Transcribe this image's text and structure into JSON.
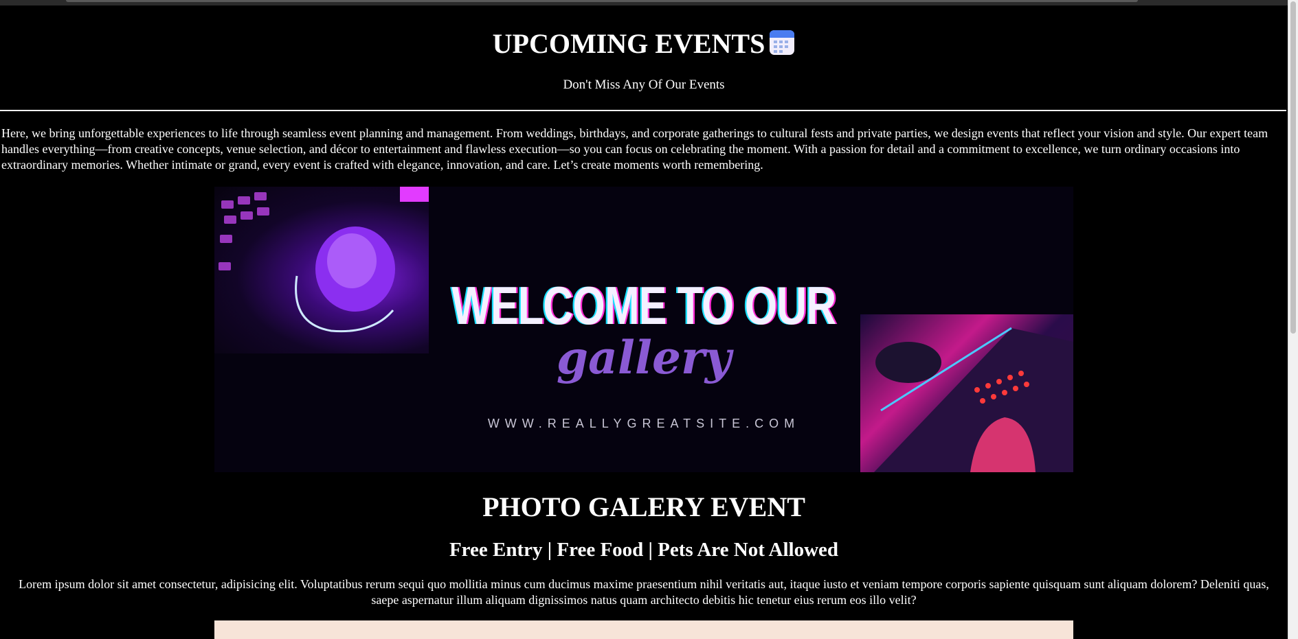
{
  "page": {
    "title": "UPCOMING EVENTS",
    "title_icon": "calendar-icon",
    "subtitle": "Don't Miss Any Of Our Events",
    "intro": "Here, we bring unforgettable experiences to life through seamless event planning and management. From weddings, birthdays, and corporate gatherings to cultural fests and private parties, we design events that reflect your vision and style. Our expert team handles everything—from creative concepts, venue selection, and décor to entertainment and flawless execution—so you can focus on celebrating the moment. With a passion for detail and a commitment to excellence, we turn ordinary occasions into extraordinary memories. Whether intimate or grand, every event is crafted with elegance, innovation, and care. Let’s create moments worth remembering."
  },
  "banner": {
    "headline": "WELCOME TO OUR",
    "script_word": "gallery",
    "site": "WWW.REALLYGREATSITE.COM"
  },
  "event": {
    "title": "PHOTO GALERY EVENT",
    "features": "Free Entry | Free Food | Pets Are Not Allowed",
    "description": "Lorem ipsum dolor sit amet consectetur, adipisicing elit. Voluptatibus rerum sequi quo mollitia minus cum ducimus maxime praesentium nihil veritatis aut, itaque iusto et veniam tempore corporis sapiente quisquam sunt aliquam dolorem? Deleniti quas, saepe aspernatur illum aliquam dignissimos natus quam architecto debitis hic tenetur eius rerum eos illo velit?"
  },
  "colors": {
    "background": "#000000",
    "text": "#ffffff",
    "accent_purple": "#8a5ad4",
    "next_image": "#f7e4d8"
  }
}
